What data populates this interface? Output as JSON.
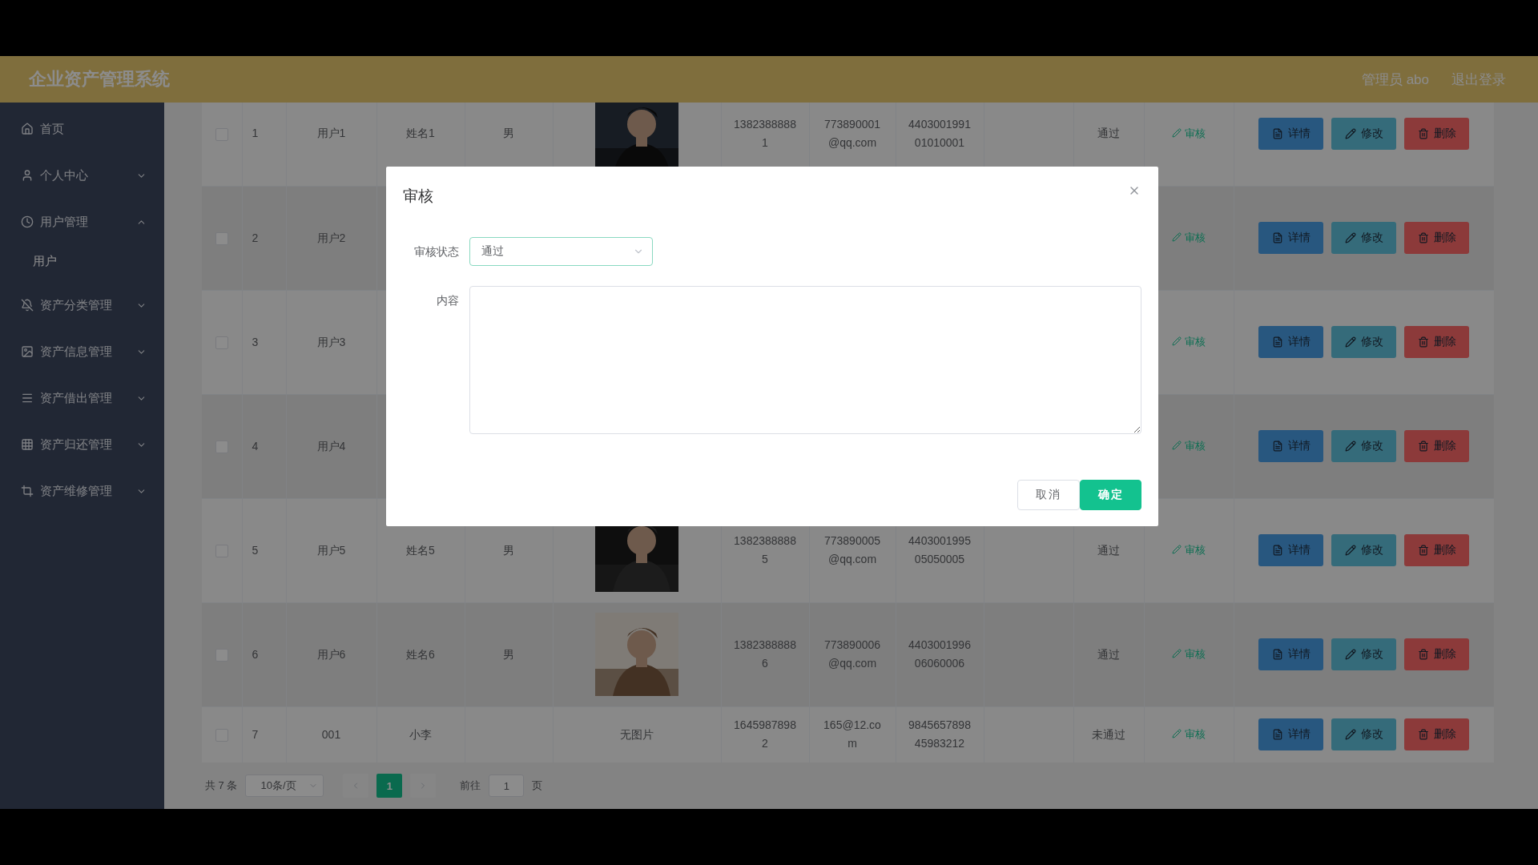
{
  "header": {
    "title": "企业资产管理系统",
    "user": "管理员 abo",
    "logout": "退出登录"
  },
  "sidebar": [
    {
      "kind": "link",
      "label": "首页"
    },
    {
      "kind": "group",
      "label": "个人中心",
      "expanded": false
    },
    {
      "kind": "group",
      "label": "用户管理",
      "expanded": true,
      "children": [
        {
          "label": "用户"
        }
      ]
    },
    {
      "kind": "group",
      "label": "资产分类管理",
      "expanded": false
    },
    {
      "kind": "group",
      "label": "资产信息管理",
      "expanded": false
    },
    {
      "kind": "group",
      "label": "资产借出管理",
      "expanded": false
    },
    {
      "kind": "group",
      "label": "资产归还管理",
      "expanded": false
    },
    {
      "kind": "group",
      "label": "资产维修管理",
      "expanded": false
    }
  ],
  "table": {
    "rows": [
      {
        "checked": false,
        "index": "1",
        "username": "用户1",
        "name": "姓名1",
        "gender": "男",
        "phone": "13823888881",
        "email": "773890001@qq.com",
        "id_card": "440300199101010001",
        "status": "通过",
        "audit": "审核",
        "actions": [
          "详情",
          "修改",
          "删除"
        ]
      },
      {
        "checked": false,
        "index": "2",
        "username": "用户2",
        "audit": "审核",
        "actions": [
          "详情",
          "修改",
          "删除"
        ]
      },
      {
        "checked": false,
        "index": "3",
        "username": "用户3",
        "audit": "审核",
        "actions": [
          "详情",
          "修改",
          "删除"
        ]
      },
      {
        "checked": false,
        "index": "4",
        "username": "用户4",
        "audit": "审核",
        "actions": [
          "详情",
          "修改",
          "删除"
        ]
      },
      {
        "checked": false,
        "index": "5",
        "username": "用户5",
        "name": "姓名5",
        "gender": "男",
        "phone": "13823888885",
        "email": "773890005@qq.com",
        "id_card": "440300199505050005",
        "status": "通过",
        "audit": "审核",
        "actions": [
          "详情",
          "修改",
          "删除"
        ]
      },
      {
        "checked": false,
        "index": "6",
        "username": "用户6",
        "name": "姓名6",
        "gender": "男",
        "phone": "13823888886",
        "email": "773890006@qq.com",
        "id_card": "440300199606060006",
        "status": "通过",
        "audit": "审核",
        "actions": [
          "详情",
          "修改",
          "删除"
        ]
      },
      {
        "checked": false,
        "index": "7",
        "username": "001",
        "name": "小李",
        "image": {
          "kind": "text",
          "text": "无图片"
        },
        "phone": "16459878982",
        "email": "165@12.com",
        "id_card": "984565789845983212",
        "status": "未通过",
        "audit": "审核",
        "actions": [
          "详情",
          "修改",
          "删除"
        ]
      }
    ]
  },
  "pagination": {
    "total": "共 7 条",
    "page_size": "10条/页",
    "pages": [
      {
        "label": "1",
        "selected": true
      }
    ],
    "goto_label": "前往",
    "goto_value": "1",
    "goto_suffix": "页"
  },
  "dialog": {
    "title": "审核",
    "fields": [
      {
        "kind": "select",
        "label": "审核状态",
        "value": "通过"
      },
      {
        "kind": "textarea",
        "label": "内容"
      }
    ],
    "buttons": [
      {
        "kind": "default",
        "label": "取消"
      },
      {
        "kind": "primary",
        "label": "确定"
      }
    ]
  }
}
